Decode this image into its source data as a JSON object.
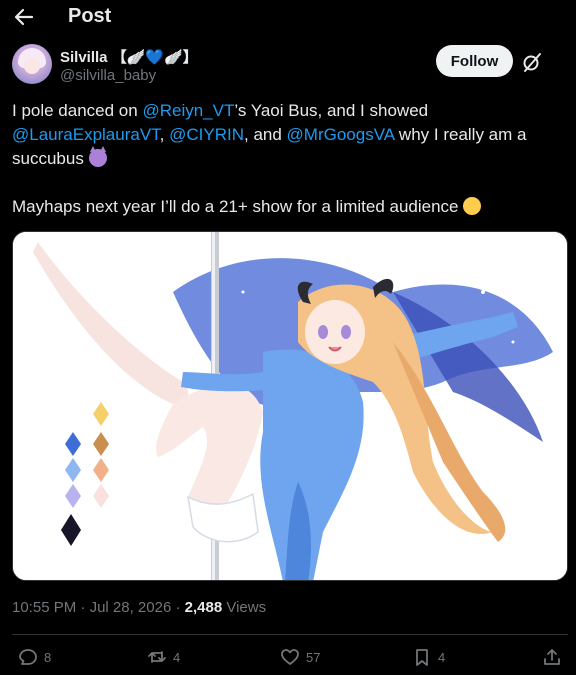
{
  "header": {
    "title": "Post",
    "back_icon": "arrow-left-icon"
  },
  "author": {
    "display_name": "Silvilla 【🪽💙🪽】",
    "handle": "@silvilla_baby",
    "follow_label": "Follow"
  },
  "tweet": {
    "line1_a": "I pole danced on ",
    "mention1": "@Reiyn_VT",
    "line1_b": "’s Yaoi Bus, and I showed ",
    "mention2": "@LauraExplauraVT",
    "sep1": ", ",
    "mention3": "@CIYRIN",
    "sep2": ", and ",
    "mention4": "@MrGoogsVA",
    "line1_c": " why I really am a succubus ",
    "emoji1": "smiling-face-with-horns",
    "line2": "Mayhaps next year I’ll do a 21+ show for a limited audience ",
    "emoji2": "winking-face",
    "mention_color": "#1d9bf0"
  },
  "media": {
    "description": "anime-girl-pole-dance-illustration"
  },
  "meta": {
    "time": "10:55 PM",
    "sep1": " · ",
    "date": "Jul 28, 2026",
    "sep2": " · ",
    "views_count": "2,488",
    "views_label": " Views"
  },
  "actions": {
    "replies": "8",
    "reposts": "4",
    "likes": "57",
    "bookmarks": "4"
  }
}
